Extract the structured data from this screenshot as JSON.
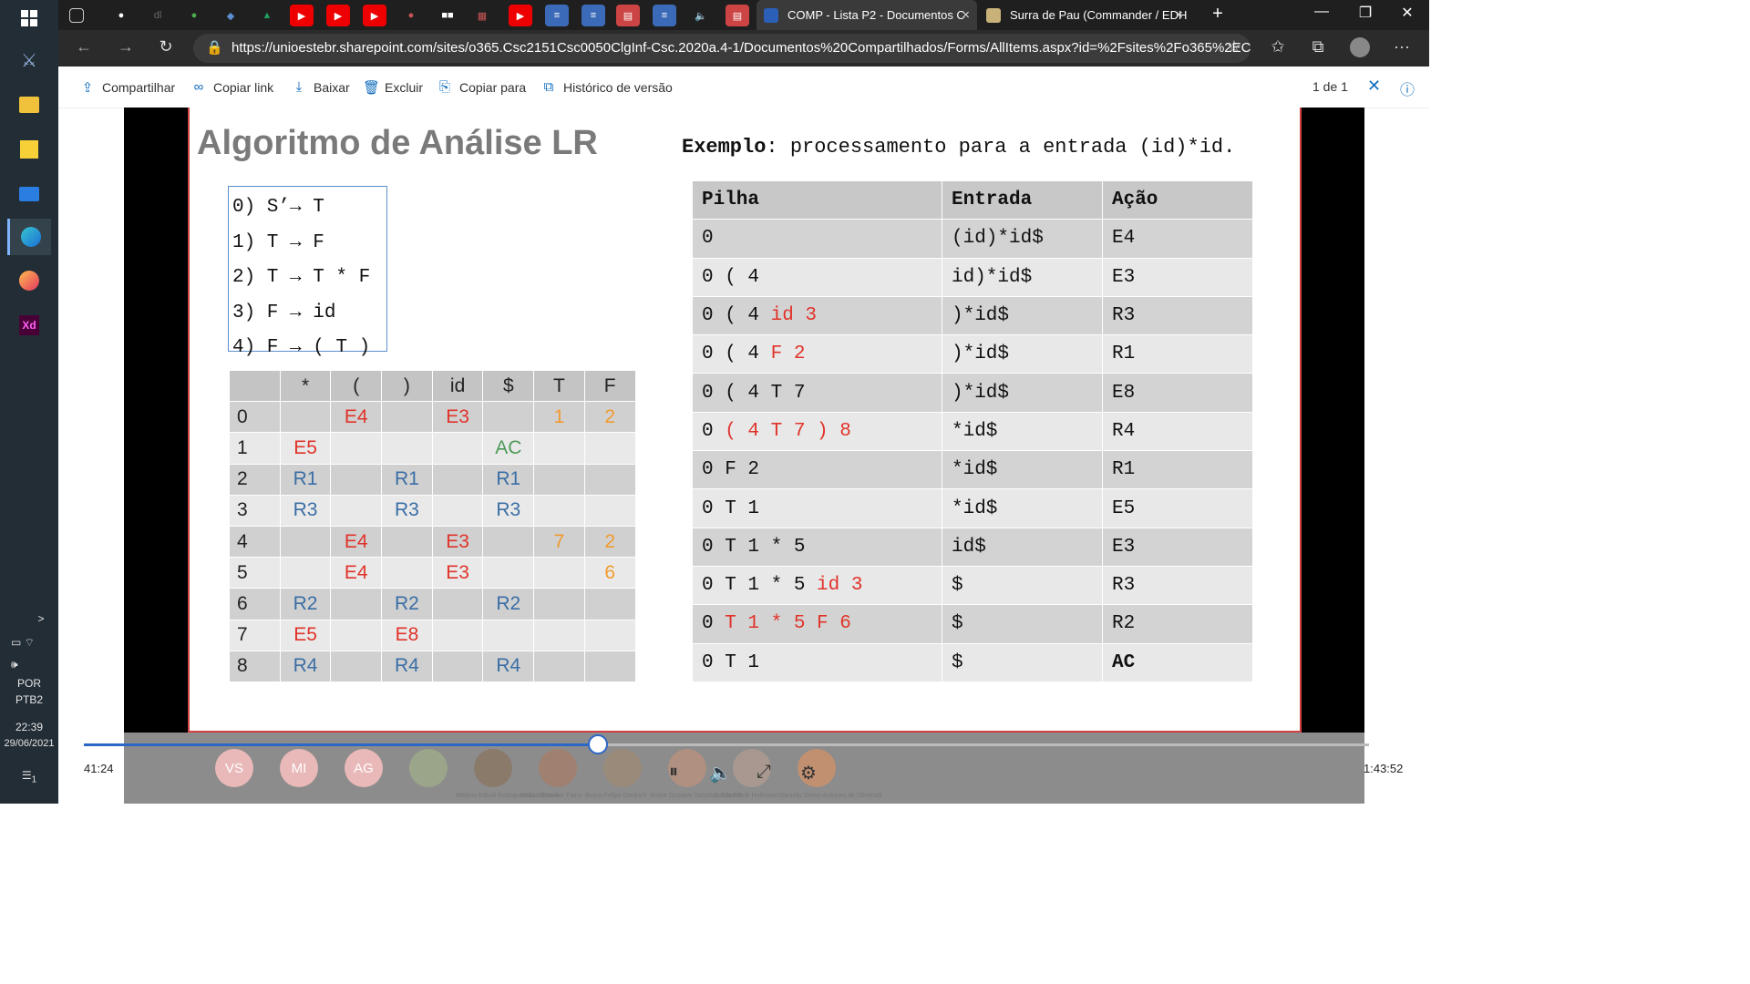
{
  "taskbar": {
    "items": [
      "windows-start",
      "acer-app",
      "file-explorer",
      "sticky-notes",
      "mail",
      "edge",
      "firefox",
      "adobe-xd"
    ],
    "tray": {
      "lang1": "POR",
      "lang2": "PTB2",
      "time": "22:39",
      "date": "29/06/2021",
      "notification_count": "1",
      "expand": ">"
    }
  },
  "browser": {
    "tabs": [
      {
        "title": "COMP - Lista P2 - Documentos C",
        "close": "×"
      },
      {
        "title": "Surra de Pau (Commander / EDH",
        "close": "×"
      }
    ],
    "new_tab": "+",
    "url": "https://unioestebr.sharepoint.com/sites/o365.Csc2151Csc0050ClgInf-Csc.2020a.4-1/Documentos%20Compartilhados/Forms/AllItems.aspx?id=%2Fsites%2Fo365%2ECsc..."
  },
  "commandbar": {
    "share": "Compartilhar",
    "copy_link": "Copiar link",
    "download": "Baixar",
    "delete": "Excluir",
    "copy_to": "Copiar para",
    "version_history": "Histórico de versão",
    "page_count": "1 de 1"
  },
  "slide": {
    "title": "Algoritmo de Análise LR",
    "grammar": [
      "0) S’→ T",
      "1) T → F",
      "2) T → T * F",
      "3) F → id",
      "4) F → ( T )"
    ],
    "parse_table": {
      "headers": [
        "",
        "*",
        "(",
        ")",
        "id",
        "$",
        "T",
        "F"
      ],
      "rows": [
        [
          "0",
          "",
          "E4",
          "",
          "E3",
          "",
          "1",
          "2"
        ],
        [
          "1",
          "E5",
          "",
          "",
          "",
          "AC",
          "",
          ""
        ],
        [
          "2",
          "R1",
          "",
          "R1",
          "",
          "R1",
          "",
          ""
        ],
        [
          "3",
          "R3",
          "",
          "R3",
          "",
          "R3",
          "",
          ""
        ],
        [
          "4",
          "",
          "E4",
          "",
          "E3",
          "",
          "7",
          "2"
        ],
        [
          "5",
          "",
          "E4",
          "",
          "E3",
          "",
          "",
          "6"
        ],
        [
          "6",
          "R2",
          "",
          "R2",
          "",
          "R2",
          "",
          ""
        ],
        [
          "7",
          "E5",
          "",
          "E8",
          "",
          "",
          "",
          ""
        ],
        [
          "8",
          "R4",
          "",
          "R4",
          "",
          "R4",
          "",
          ""
        ]
      ]
    },
    "example_bold": "Exemplo",
    "example_text": ": processamento para a entrada (id)*id.",
    "trace": {
      "headers": [
        "Pilha",
        "Entrada",
        "Ação"
      ],
      "rows": [
        {
          "pilha_black": "0",
          "pilha_red": "",
          "entrada": "(id)*id$",
          "acao": "E4"
        },
        {
          "pilha_black": "0 ( 4",
          "pilha_red": "",
          "entrada": "id)*id$",
          "acao": "E3"
        },
        {
          "pilha_black": "0 ( 4",
          "pilha_red": "id 3",
          "entrada": ")*id$",
          "acao": "R3"
        },
        {
          "pilha_black": "0 ( 4",
          "pilha_red": "F 2",
          "entrada": ")*id$",
          "acao": "R1"
        },
        {
          "pilha_black": "0 ( 4 T 7",
          "pilha_red": "",
          "entrada": ")*id$",
          "acao": "E8"
        },
        {
          "pilha_black": "0",
          "pilha_red": "( 4 T 7 ) 8",
          "entrada": "*id$",
          "acao": "R4"
        },
        {
          "pilha_black": "0 F 2",
          "pilha_red": "",
          "entrada": "*id$",
          "acao": "R1"
        },
        {
          "pilha_black": "0 T 1",
          "pilha_red": "",
          "entrada": "*id$",
          "acao": "E5"
        },
        {
          "pilha_black": "0 T 1 * 5",
          "pilha_red": "",
          "entrada": "id$",
          "acao": "E3"
        },
        {
          "pilha_black": "0 T 1 * 5",
          "pilha_red": "id 3",
          "entrada": "$",
          "acao": "R3"
        },
        {
          "pilha_black": "0",
          "pilha_red": "T 1 * 5 F 6",
          "entrada": "$",
          "acao": "R2"
        },
        {
          "pilha_black": "0 T 1",
          "pilha_red": "",
          "entrada": "$",
          "acao": "AC"
        }
      ]
    }
  },
  "player": {
    "elapsed": "41:24",
    "total": "1:43:52",
    "progress": 0.4,
    "participants": [
      {
        "initials": "VS",
        "name": ""
      },
      {
        "initials": "MI",
        "name": ""
      },
      {
        "initials": "AG",
        "name": ""
      },
      {
        "initials": "",
        "name": ""
      },
      {
        "initials": "",
        "name": "Mateus Edival Rodrigues da Silveira"
      },
      {
        "initials": "",
        "name": "Willian Cavalier Faino"
      },
      {
        "initials": "",
        "name": "Bruno Felipe Diedrich"
      },
      {
        "initials": "",
        "name": "Andre Gustavo Sanches Silva28"
      },
      {
        "initials": "",
        "name": "Lucas Frank Hollmann"
      },
      {
        "initials": "",
        "name": "Danielly Omori Antunes de Oliveira5"
      }
    ]
  },
  "colors": {
    "red": "#e0332a",
    "blue": "#3a6ea5",
    "orange": "#f29a2e",
    "green": "#4e9a5a"
  }
}
